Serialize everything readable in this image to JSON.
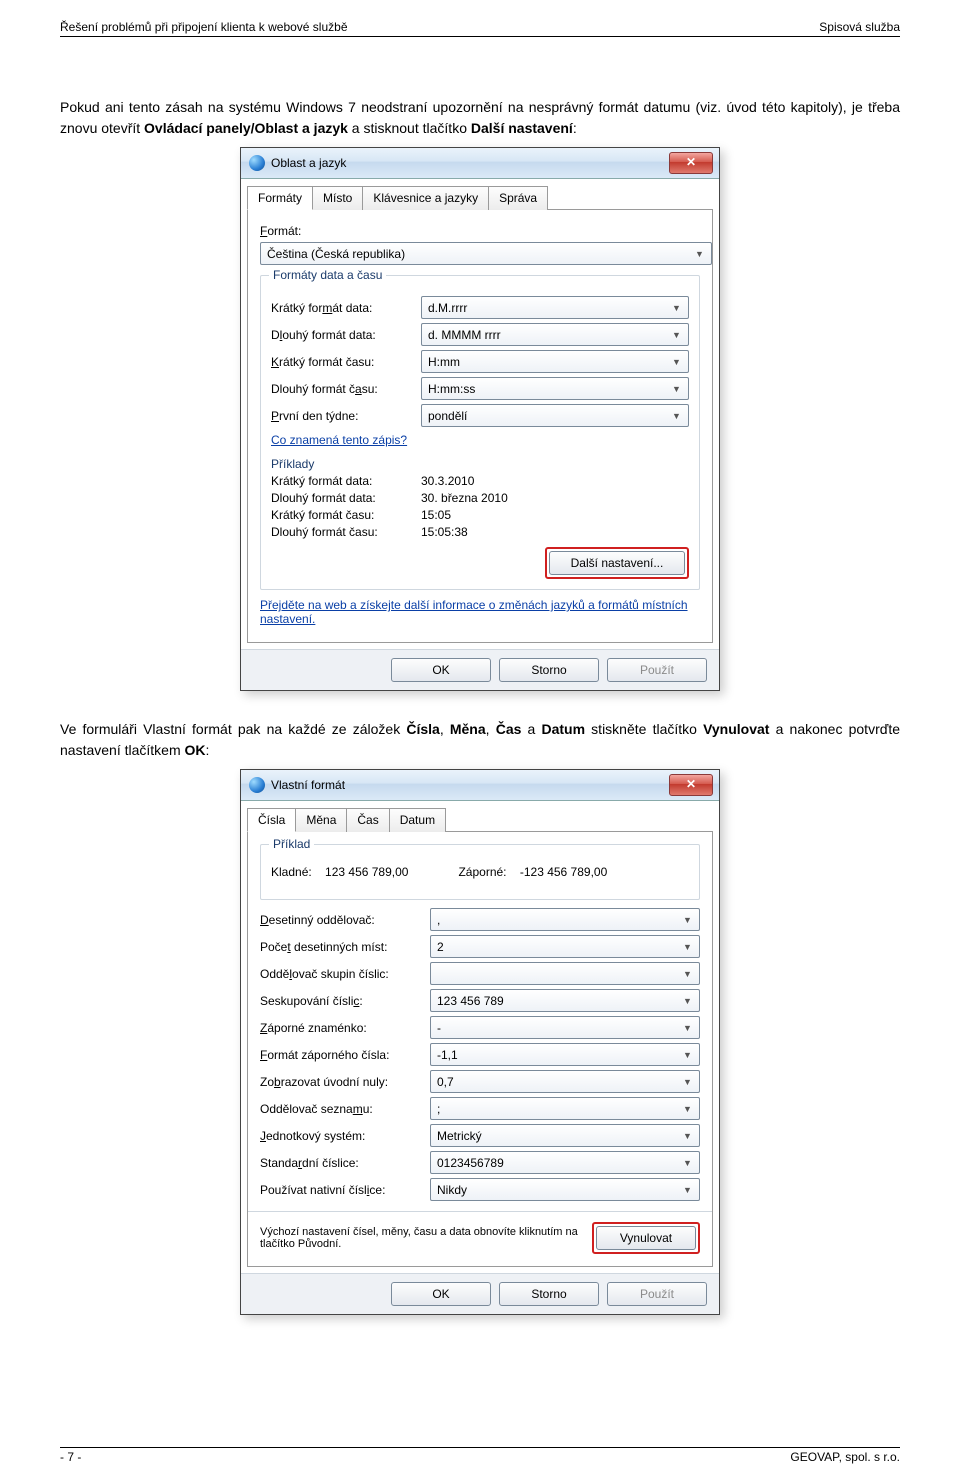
{
  "header": {
    "left": "Řešení problémů při připojení klienta k webové službě",
    "right": "Spisová služba"
  },
  "para1": {
    "pre": "Pokud ani tento zásah na systému Windows 7 neodstraní upozornění na nesprávný formát datumu (viz. úvod této kapitoly), je třeba znovu otevřít ",
    "b1": "Ovládací panely/Oblast a jazyk",
    "mid": " a stisknout tlačítko ",
    "b2": "Další nastavení",
    "post": ":"
  },
  "dlg1": {
    "title": "Oblast a jazyk",
    "tabs": [
      "Formáty",
      "Místo",
      "Klávesnice a jazyky",
      "Správa"
    ],
    "format_label_pre": "",
    "format_label_u": "F",
    "format_label_post": "ormát:",
    "format_value": "Čeština (Česká republika)",
    "group1": "Formáty data a času",
    "rows": [
      {
        "pre": "Krátký for",
        "u": "m",
        "post": "át data:",
        "val": "d.M.rrrr"
      },
      {
        "pre": "D",
        "u": "l",
        "post": "ouhý formát data:",
        "val": "d. MMMM rrrr"
      },
      {
        "pre": "",
        "u": "K",
        "post": "rátký formát času:",
        "val": "H:mm"
      },
      {
        "pre": "Dlouhý formát č",
        "u": "a",
        "post": "su:",
        "val": "H:mm:ss"
      },
      {
        "pre": "",
        "u": "P",
        "post": "rvní den týdne:",
        "val": "pondělí"
      }
    ],
    "link1": "Co znamená tento zápis?",
    "group2": "Příklady",
    "ex": [
      {
        "l": "Krátký formát data:",
        "v": "30.3.2010"
      },
      {
        "l": "Dlouhý formát data:",
        "v": "30. března 2010"
      },
      {
        "l": "Krátký formát času:",
        "v": "15:05"
      },
      {
        "l": "Dlouhý formát času:",
        "v": "15:05:38"
      }
    ],
    "more": "Další nastavení...",
    "link2": "Přejděte na web a získejte další informace o změnách jazyků a formátů místních nastavení.",
    "ok": "OK",
    "cancel": "Storno",
    "apply": "Použít"
  },
  "para2": {
    "pre": "Ve formuláři Vlastní formát pak na každé ze záložek ",
    "b1": "Čísla",
    "s1": ", ",
    "b2": "Měna",
    "s2": ", ",
    "b3": "Čas",
    "s3": " a ",
    "b4": "Datum",
    "mid": " stiskněte tlačítko ",
    "b5": "Vynulovat",
    "s4": " a nakonec potvrďte nastavení tlačítkem ",
    "b6": "OK",
    "post": ":"
  },
  "dlg2": {
    "title": "Vlastní formát",
    "tabs": [
      "Čísla",
      "Měna",
      "Čas",
      "Datum"
    ],
    "group": "Příklad",
    "pos_l": "Kladné:",
    "pos_v": "123 456 789,00",
    "neg_l": "Záporné:",
    "neg_v": "-123 456 789,00",
    "rows": [
      {
        "pre": "",
        "u": "D",
        "post": "esetinný oddělovač:",
        "val": ","
      },
      {
        "pre": "Poče",
        "u": "t",
        "post": " desetinných míst:",
        "val": "2"
      },
      {
        "pre": "Oddě",
        "u": "l",
        "post": "ovač skupin číslic:",
        "val": ""
      },
      {
        "pre": "Seskupování čísli",
        "u": "c",
        "post": ":",
        "val": "123 456 789"
      },
      {
        "pre": "",
        "u": "Z",
        "post": "áporné znaménko:",
        "val": "-"
      },
      {
        "pre": "",
        "u": "F",
        "post": "ormát záporného čísla:",
        "val": "-1,1"
      },
      {
        "pre": "Zo",
        "u": "b",
        "post": "razovat úvodní nuly:",
        "val": "0,7"
      },
      {
        "pre": "Oddělovač sezna",
        "u": "m",
        "post": "u:",
        "val": ";"
      },
      {
        "pre": "",
        "u": "J",
        "post": "ednotkový systém:",
        "val": "Metrický"
      },
      {
        "pre": "Standa",
        "u": "r",
        "post": "dní číslice:",
        "val": "0123456789"
      },
      {
        "pre": "Používat nativní čísl",
        "u": "i",
        "post": "ce:",
        "val": "Nikdy"
      }
    ],
    "reset_text": "Výchozí nastavení čísel, měny, času a data obnovíte kliknutím na tlačítko Původní.",
    "reset": "Vynulovat",
    "ok": "OK",
    "cancel": "Storno",
    "apply": "Použít"
  },
  "footer": {
    "left": "- 7 -",
    "right": "GEOVAP, spol. s r.o."
  }
}
